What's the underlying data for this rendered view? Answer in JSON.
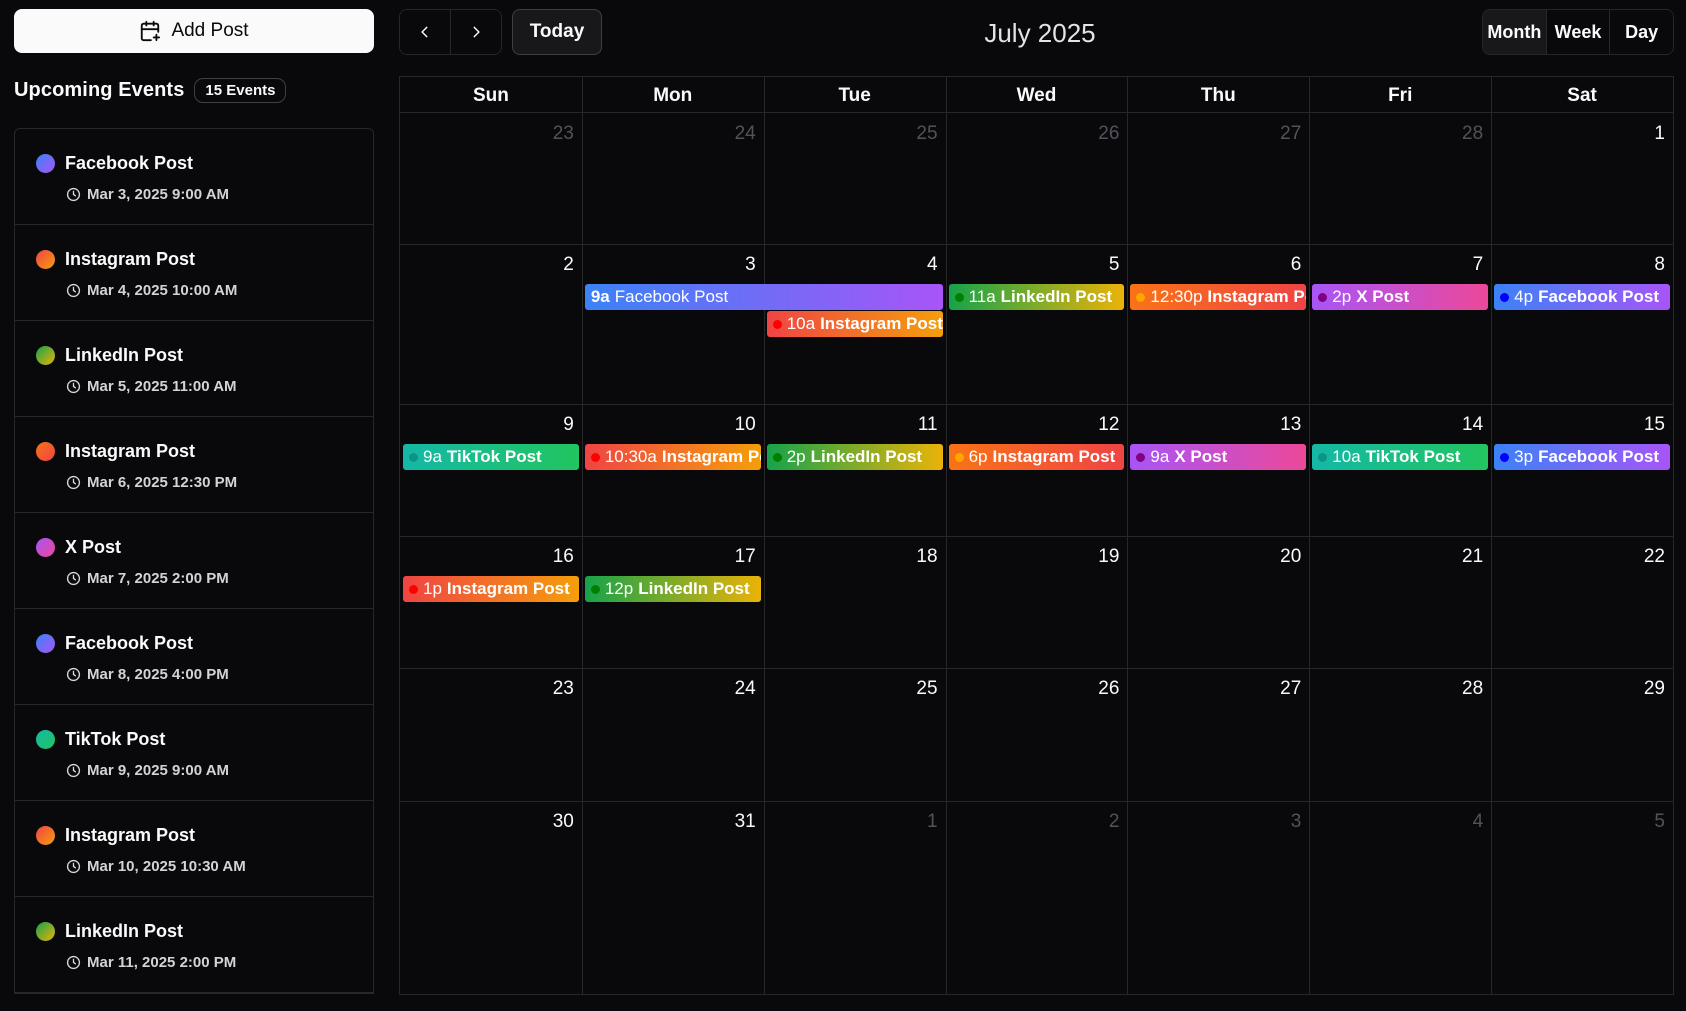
{
  "sidebar": {
    "add_post_label": "Add Post",
    "upcoming_title": "Upcoming Events",
    "events_count": "15 Events",
    "events": [
      {
        "title": "Facebook Post",
        "datetime": "Mar 3, 2025 9:00 AM",
        "gradient": [
          "#3b82f6",
          "#a855f7"
        ]
      },
      {
        "title": "Instagram Post",
        "datetime": "Mar 4, 2025 10:00 AM",
        "gradient": [
          "#ef4444",
          "#f59e0b"
        ]
      },
      {
        "title": "LinkedIn Post",
        "datetime": "Mar 5, 2025 11:00 AM",
        "gradient": [
          "#16a34a",
          "#eab308"
        ]
      },
      {
        "title": "Instagram Post",
        "datetime": "Mar 6, 2025 12:30 PM",
        "gradient": [
          "#f97316",
          "#ef4444"
        ]
      },
      {
        "title": "X Post",
        "datetime": "Mar 7, 2025 2:00 PM",
        "gradient": [
          "#a855f7",
          "#ec4899"
        ]
      },
      {
        "title": "Facebook Post",
        "datetime": "Mar 8, 2025 4:00 PM",
        "gradient": [
          "#3b82f6",
          "#a855f7"
        ]
      },
      {
        "title": "TikTok Post",
        "datetime": "Mar 9, 2025 9:00 AM",
        "gradient": [
          "#14b8a6",
          "#22c55e"
        ]
      },
      {
        "title": "Instagram Post",
        "datetime": "Mar 10, 2025 10:30 AM",
        "gradient": [
          "#ef4444",
          "#f59e0b"
        ]
      },
      {
        "title": "LinkedIn Post",
        "datetime": "Mar 11, 2025 2:00 PM",
        "gradient": [
          "#16a34a",
          "#eab308"
        ]
      }
    ]
  },
  "header": {
    "prev_icon": "chevron-left-icon",
    "next_icon": "chevron-right-icon",
    "today_label": "Today",
    "month_title": "July 2025",
    "views": [
      {
        "label": "Month",
        "active": true
      },
      {
        "label": "Week",
        "active": false
      },
      {
        "label": "Day",
        "active": false
      }
    ]
  },
  "calendar": {
    "weekdays": [
      "Sun",
      "Mon",
      "Tue",
      "Wed",
      "Thu",
      "Fri",
      "Sat"
    ],
    "weeks": [
      [
        {
          "d": "23",
          "m": true
        },
        {
          "d": "24",
          "m": true
        },
        {
          "d": "25",
          "m": true
        },
        {
          "d": "26",
          "m": true
        },
        {
          "d": "27",
          "m": true
        },
        {
          "d": "28",
          "m": true
        },
        {
          "d": "1",
          "m": false
        }
      ],
      [
        {
          "d": "2",
          "m": false
        },
        {
          "d": "3",
          "m": false
        },
        {
          "d": "4",
          "m": false
        },
        {
          "d": "5",
          "m": false
        },
        {
          "d": "6",
          "m": false
        },
        {
          "d": "7",
          "m": false
        },
        {
          "d": "8",
          "m": false
        }
      ],
      [
        {
          "d": "9",
          "m": false
        },
        {
          "d": "10",
          "m": false
        },
        {
          "d": "11",
          "m": false
        },
        {
          "d": "12",
          "m": false
        },
        {
          "d": "13",
          "m": false
        },
        {
          "d": "14",
          "m": false
        },
        {
          "d": "15",
          "m": false
        }
      ],
      [
        {
          "d": "16",
          "m": false
        },
        {
          "d": "17",
          "m": false
        },
        {
          "d": "18",
          "m": false
        },
        {
          "d": "19",
          "m": false
        },
        {
          "d": "20",
          "m": false
        },
        {
          "d": "21",
          "m": false
        },
        {
          "d": "22",
          "m": false
        }
      ],
      [
        {
          "d": "23",
          "m": false
        },
        {
          "d": "24",
          "m": false
        },
        {
          "d": "25",
          "m": false
        },
        {
          "d": "26",
          "m": false
        },
        {
          "d": "27",
          "m": false
        },
        {
          "d": "28",
          "m": false
        },
        {
          "d": "29",
          "m": false
        }
      ],
      [
        {
          "d": "30",
          "m": false
        },
        {
          "d": "31",
          "m": false
        },
        {
          "d": "1",
          "m": true
        },
        {
          "d": "2",
          "m": true
        },
        {
          "d": "3",
          "m": true
        },
        {
          "d": "4",
          "m": true
        },
        {
          "d": "5",
          "m": true
        }
      ]
    ],
    "events": [
      {
        "week": 1,
        "day": 1,
        "span": 2,
        "lane": 0,
        "time": "9a",
        "name": "Facebook Post",
        "long": true,
        "dot": "",
        "gradient": [
          "#3b82f6",
          "#a855f7"
        ]
      },
      {
        "week": 1,
        "day": 2,
        "span": 1,
        "lane": 1,
        "time": "10a",
        "name": "Instagram Post",
        "long": false,
        "dot": "#ff0000",
        "gradient": [
          "#ef4444",
          "#f59e0b"
        ]
      },
      {
        "week": 1,
        "day": 3,
        "span": 1,
        "lane": 0,
        "time": "11a",
        "name": "LinkedIn Post",
        "long": false,
        "dot": "#008000",
        "gradient": [
          "#16a34a",
          "#eab308"
        ]
      },
      {
        "week": 1,
        "day": 4,
        "span": 1,
        "lane": 0,
        "time": "12:30p",
        "name": "Instagram Post",
        "long": false,
        "dot": "#ffa500",
        "gradient": [
          "#f97316",
          "#ef4444"
        ]
      },
      {
        "week": 1,
        "day": 5,
        "span": 1,
        "lane": 0,
        "time": "2p",
        "name": "X Post",
        "long": false,
        "dot": "#800080",
        "gradient": [
          "#a855f7",
          "#ec4899"
        ]
      },
      {
        "week": 1,
        "day": 6,
        "span": 1,
        "lane": 0,
        "time": "4p",
        "name": "Facebook Post",
        "long": false,
        "dot": "#0000ff",
        "gradient": [
          "#3b82f6",
          "#a855f7"
        ]
      },
      {
        "week": 2,
        "day": 0,
        "span": 1,
        "lane": 0,
        "time": "9a",
        "name": "TikTok Post",
        "long": false,
        "dot": "#0d9488",
        "gradient": [
          "#14b8a6",
          "#22c55e"
        ]
      },
      {
        "week": 2,
        "day": 1,
        "span": 1,
        "lane": 0,
        "time": "10:30a",
        "name": "Instagram Post",
        "long": false,
        "dot": "#ff0000",
        "gradient": [
          "#ef4444",
          "#f59e0b"
        ]
      },
      {
        "week": 2,
        "day": 2,
        "span": 1,
        "lane": 0,
        "time": "2p",
        "name": "LinkedIn Post",
        "long": false,
        "dot": "#008000",
        "gradient": [
          "#16a34a",
          "#eab308"
        ]
      },
      {
        "week": 2,
        "day": 3,
        "span": 1,
        "lane": 0,
        "time": "6p",
        "name": "Instagram Post",
        "long": false,
        "dot": "#ffa500",
        "gradient": [
          "#f97316",
          "#ef4444"
        ]
      },
      {
        "week": 2,
        "day": 4,
        "span": 1,
        "lane": 0,
        "time": "9a",
        "name": "X Post",
        "long": false,
        "dot": "#800080",
        "gradient": [
          "#a855f7",
          "#ec4899"
        ]
      },
      {
        "week": 2,
        "day": 5,
        "span": 1,
        "lane": 0,
        "time": "10a",
        "name": "TikTok Post",
        "long": false,
        "dot": "#0d9488",
        "gradient": [
          "#14b8a6",
          "#22c55e"
        ]
      },
      {
        "week": 2,
        "day": 6,
        "span": 1,
        "lane": 0,
        "time": "3p",
        "name": "Facebook Post",
        "long": false,
        "dot": "#0000ff",
        "gradient": [
          "#3b82f6",
          "#a855f7"
        ]
      },
      {
        "week": 3,
        "day": 0,
        "span": 1,
        "lane": 0,
        "time": "1p",
        "name": "Instagram Post",
        "long": false,
        "dot": "#ff0000",
        "gradient": [
          "#ef4444",
          "#f59e0b"
        ]
      },
      {
        "week": 3,
        "day": 1,
        "span": 1,
        "lane": 0,
        "time": "12p",
        "name": "LinkedIn Post",
        "long": false,
        "dot": "#008000",
        "gradient": [
          "#16a34a",
          "#eab308"
        ]
      }
    ]
  }
}
